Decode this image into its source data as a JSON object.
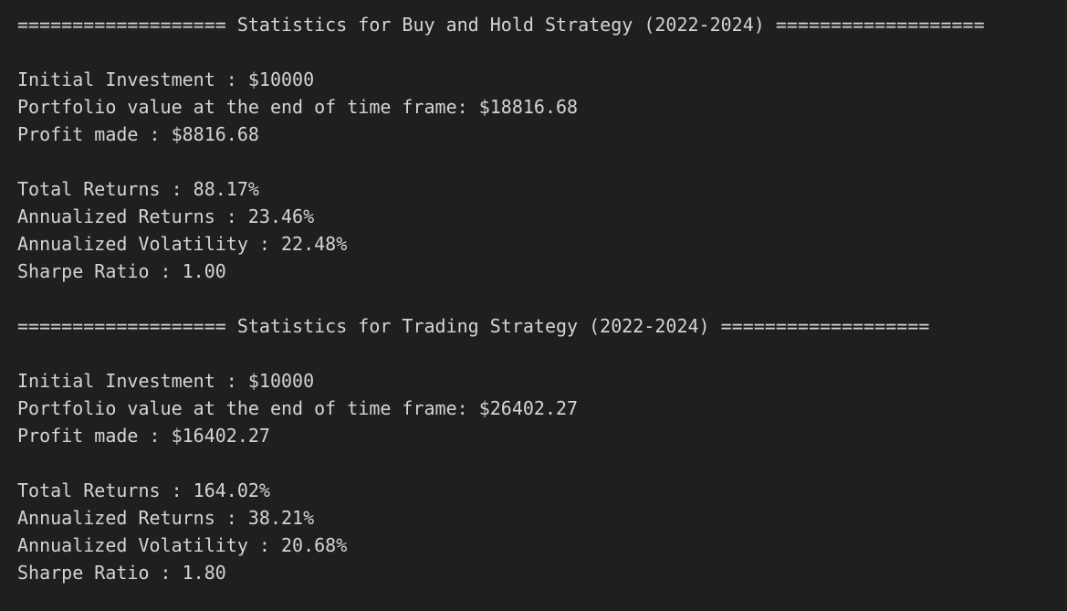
{
  "terminal": {
    "lines": [
      "=================== Statistics for Buy and Hold Strategy (2022-2024) ===================",
      "",
      "Initial Investment : $10000",
      "Portfolio value at the end of time frame: $18816.68",
      "Profit made : $8816.68",
      "",
      "Total Returns : 88.17%",
      "Annualized Returns : 23.46%",
      "Annualized Volatility : 22.48%",
      "Sharpe Ratio : 1.00",
      "",
      "=================== Statistics for Trading Strategy (2022-2024) ===================",
      "",
      "Initial Investment : $10000",
      "Portfolio value at the end of time frame: $26402.27",
      "Profit made : $16402.27",
      "",
      "Total Returns : 164.02%",
      "Annualized Returns : 38.21%",
      "Annualized Volatility : 20.68%",
      "Sharpe Ratio : 1.80"
    ]
  }
}
